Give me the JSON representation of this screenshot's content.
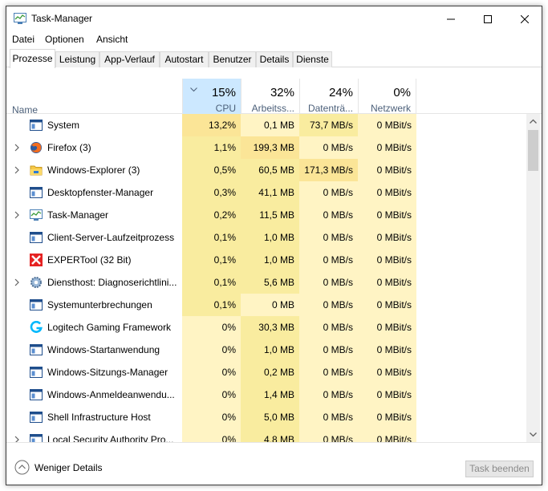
{
  "window": {
    "title": "Task-Manager"
  },
  "menu": [
    "Datei",
    "Optionen",
    "Ansicht"
  ],
  "tabs": [
    "Prozesse",
    "Leistung",
    "App-Verlauf",
    "Autostart",
    "Benutzer",
    "Details",
    "Dienste"
  ],
  "active_tab": "Prozesse",
  "columns": {
    "name": "Name",
    "cpu": {
      "pct": "15%",
      "label": "CPU"
    },
    "mem": {
      "pct": "32%",
      "label": "Arbeitss..."
    },
    "disk": {
      "pct": "24%",
      "label": "Datenträ..."
    },
    "net": {
      "pct": "0%",
      "label": "Netzwerk"
    }
  },
  "processes": [
    {
      "name": "System",
      "expandable": false,
      "icon": "system-window-icon",
      "cpu": "13,2%",
      "mem": "0,1 MB",
      "disk": "73,7 MB/s",
      "net": "0 MBit/s"
    },
    {
      "name": "Firefox (3)",
      "expandable": true,
      "icon": "firefox-icon",
      "cpu": "1,1%",
      "mem": "199,3 MB",
      "disk": "0 MB/s",
      "net": "0 MBit/s"
    },
    {
      "name": "Windows-Explorer (3)",
      "expandable": true,
      "icon": "folder-icon",
      "cpu": "0,5%",
      "mem": "60,5 MB",
      "disk": "171,3 MB/s",
      "net": "0 MBit/s"
    },
    {
      "name": "Desktopfenster-Manager",
      "expandable": false,
      "icon": "window-icon",
      "cpu": "0,3%",
      "mem": "41,1 MB",
      "disk": "0 MB/s",
      "net": "0 MBit/s"
    },
    {
      "name": "Task-Manager",
      "expandable": true,
      "icon": "task-manager-icon",
      "cpu": "0,2%",
      "mem": "11,5 MB",
      "disk": "0 MB/s",
      "net": "0 MBit/s"
    },
    {
      "name": "Client-Server-Laufzeitprozess",
      "expandable": false,
      "icon": "window-icon",
      "cpu": "0,1%",
      "mem": "1,0 MB",
      "disk": "0 MB/s",
      "net": "0 MBit/s"
    },
    {
      "name": "EXPERTool (32 Bit)",
      "expandable": false,
      "icon": "expertool-icon",
      "cpu": "0,1%",
      "mem": "1,0 MB",
      "disk": "0 MB/s",
      "net": "0 MBit/s"
    },
    {
      "name": "Diensthost: Diagnoserichtlini...",
      "expandable": true,
      "icon": "gear-icon",
      "cpu": "0,1%",
      "mem": "5,6 MB",
      "disk": "0 MB/s",
      "net": "0 MBit/s"
    },
    {
      "name": "Systemunterbrechungen",
      "expandable": false,
      "icon": "window-icon",
      "cpu": "0,1%",
      "mem": "0 MB",
      "disk": "0 MB/s",
      "net": "0 MBit/s"
    },
    {
      "name": "Logitech Gaming Framework",
      "expandable": false,
      "icon": "logitech-icon",
      "cpu": "0%",
      "mem": "30,3 MB",
      "disk": "0 MB/s",
      "net": "0 MBit/s"
    },
    {
      "name": "Windows-Startanwendung",
      "expandable": false,
      "icon": "window-icon",
      "cpu": "0%",
      "mem": "1,0 MB",
      "disk": "0 MB/s",
      "net": "0 MBit/s"
    },
    {
      "name": "Windows-Sitzungs-Manager",
      "expandable": false,
      "icon": "window-icon",
      "cpu": "0%",
      "mem": "0,2 MB",
      "disk": "0 MB/s",
      "net": "0 MBit/s"
    },
    {
      "name": "Windows-Anmeldeanwendu...",
      "expandable": false,
      "icon": "window-icon",
      "cpu": "0%",
      "mem": "1,4 MB",
      "disk": "0 MB/s",
      "net": "0 MBit/s"
    },
    {
      "name": "Shell Infrastructure Host",
      "expandable": false,
      "icon": "window-icon",
      "cpu": "0%",
      "mem": "5,0 MB",
      "disk": "0 MB/s",
      "net": "0 MBit/s"
    },
    {
      "name": "Local Security Authority Pro...",
      "expandable": true,
      "icon": "window-icon",
      "cpu": "0%",
      "mem": "4,8 MB",
      "disk": "0 MB/s",
      "net": "0 MBit/s"
    }
  ],
  "footer": {
    "fewer_details": "Weniger Details",
    "end_task": "Task beenden"
  }
}
